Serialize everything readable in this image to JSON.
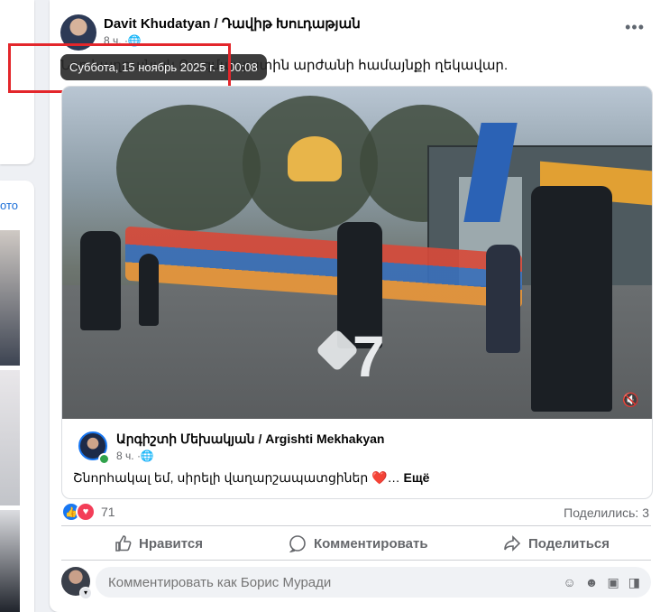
{
  "post": {
    "author": "Davit Khudatyan / Դավիթ Խուդաթյան",
    "time_short": "8 ч.",
    "text": "Նոր հաղթանակ Ռազմապատին արժանի համայնքի ղեկավար.",
    "tooltip": "Суббота, 15 ноябрь 2025 г. в 00:08",
    "menu": "•••"
  },
  "shared": {
    "video_mute_icon": "speaker-muted-icon",
    "overlay_number": "7",
    "author": "Արգիշտի Մեխակյան / Argishti Mekhakyan",
    "time": "8 ч.",
    "text": "Շնորհակալ եմ, սիրելի վաղարշապատցիներ ❤️…",
    "more": "Ещё"
  },
  "reactions": {
    "count": "71",
    "shares": "Поделились: 3"
  },
  "actions": {
    "like": "Нравится",
    "comment": "Комментировать",
    "share": "Поделиться"
  },
  "comment_box": {
    "placeholder": "Комментировать как Борис Муради"
  },
  "left_rail": {
    "link_fragment": "ото"
  },
  "colors": {
    "accent": "#1877f2",
    "highlight_box": "#e3262b",
    "love": "#f33e58",
    "online": "#31a24c"
  }
}
